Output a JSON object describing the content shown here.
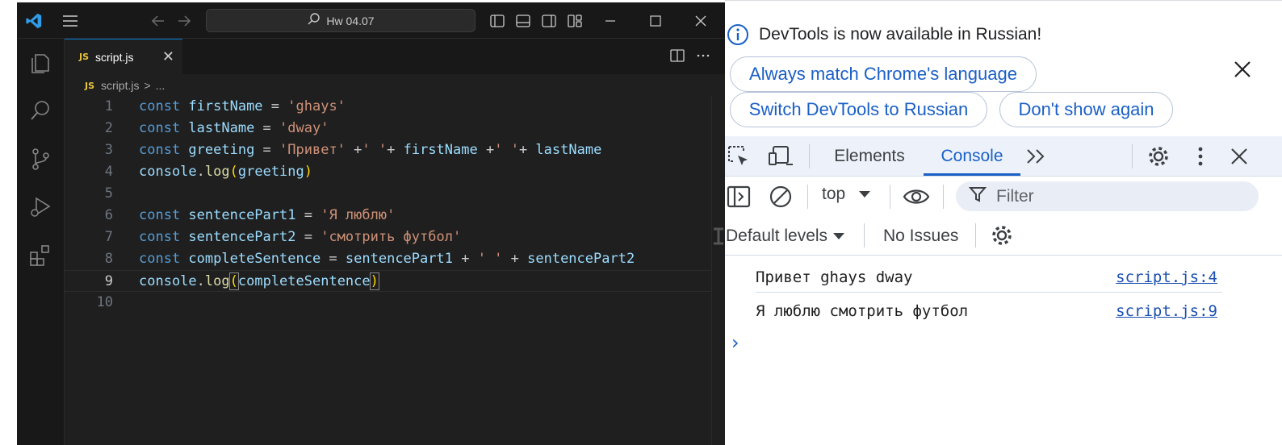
{
  "vscode": {
    "title_search": "Hw 04.07",
    "tab": {
      "badge": "JS",
      "label": "script.js"
    },
    "breadcrumb": {
      "badge": "JS",
      "file": "script.js",
      "separator": ">",
      "more": "..."
    },
    "code": [
      {
        "n": "1",
        "tokens": [
          [
            "kw",
            "const"
          ],
          [
            "var",
            " firstName"
          ],
          [
            "p",
            " = "
          ],
          [
            "str",
            "'ghays'"
          ]
        ]
      },
      {
        "n": "2",
        "tokens": [
          [
            "kw",
            "const"
          ],
          [
            "var",
            " lastName"
          ],
          [
            "p",
            " = "
          ],
          [
            "str",
            "'dway'"
          ]
        ]
      },
      {
        "n": "3",
        "tokens": [
          [
            "kw",
            "const"
          ],
          [
            "var",
            " greeting"
          ],
          [
            "p",
            " = "
          ],
          [
            "str",
            "'Привет'"
          ],
          [
            "p",
            " +"
          ],
          [
            "str",
            "' '"
          ],
          [
            "p",
            "+ "
          ],
          [
            "var",
            "firstName"
          ],
          [
            "p",
            " +"
          ],
          [
            "str",
            "' '"
          ],
          [
            "p",
            "+ "
          ],
          [
            "var",
            "lastName"
          ]
        ]
      },
      {
        "n": "4",
        "tokens": [
          [
            "var",
            "console"
          ],
          [
            "p",
            "."
          ],
          [
            "fn",
            "log"
          ],
          [
            "br",
            "("
          ],
          [
            "var",
            "greeting"
          ],
          [
            "br",
            ")"
          ]
        ]
      },
      {
        "n": "5",
        "tokens": []
      },
      {
        "n": "6",
        "tokens": [
          [
            "kw",
            "const"
          ],
          [
            "var",
            " sentencePart1"
          ],
          [
            "p",
            " = "
          ],
          [
            "str",
            "'Я люблю'"
          ]
        ]
      },
      {
        "n": "7",
        "tokens": [
          [
            "kw",
            "const"
          ],
          [
            "var",
            " sentencePart2"
          ],
          [
            "p",
            " = "
          ],
          [
            "str",
            "'смотрить футбол'"
          ]
        ]
      },
      {
        "n": "8",
        "tokens": [
          [
            "kw",
            "const"
          ],
          [
            "var",
            " completeSentence"
          ],
          [
            "p",
            " = "
          ],
          [
            "var",
            "sentencePart1"
          ],
          [
            "p",
            " + "
          ],
          [
            "str",
            "' '"
          ],
          [
            "p",
            " + "
          ],
          [
            "var",
            "sentencePart2"
          ]
        ]
      },
      {
        "n": "9",
        "tokens": [
          [
            "var",
            "console"
          ],
          [
            "p",
            "."
          ],
          [
            "fn",
            "log"
          ],
          [
            "bm",
            "("
          ],
          [
            "var",
            "completeSentence"
          ],
          [
            "bm",
            ")"
          ]
        ]
      },
      {
        "n": "10",
        "tokens": []
      }
    ],
    "active_line": "9",
    "colors": {
      "keyword": "#569cd6",
      "variable": "#9cdcfe",
      "string": "#ce9178",
      "function": "#dcdcaa",
      "bracket": "#ffd700",
      "accent": "#0078d4"
    }
  },
  "devtools": {
    "infobar": {
      "message": "DevTools is now available in Russian!",
      "always_match": "Always match Chrome's language",
      "switch_russian": "Switch DevTools to Russian",
      "dont_show": "Don't show again"
    },
    "tabs": {
      "elements": "Elements",
      "console": "Console"
    },
    "console_toolbar": {
      "context": "top",
      "filter_placeholder": "Filter"
    },
    "levels": {
      "default_levels": "Default levels",
      "issues": "No Issues"
    },
    "logs": [
      {
        "message": "Привет ghays dway",
        "source": "script.js:4"
      },
      {
        "message": "Я люблю смотрить футбол",
        "source": "script.js:9"
      }
    ],
    "prompt": "›",
    "colors": {
      "link": "#1a4fb0",
      "accent": "#1a5fc6"
    }
  }
}
